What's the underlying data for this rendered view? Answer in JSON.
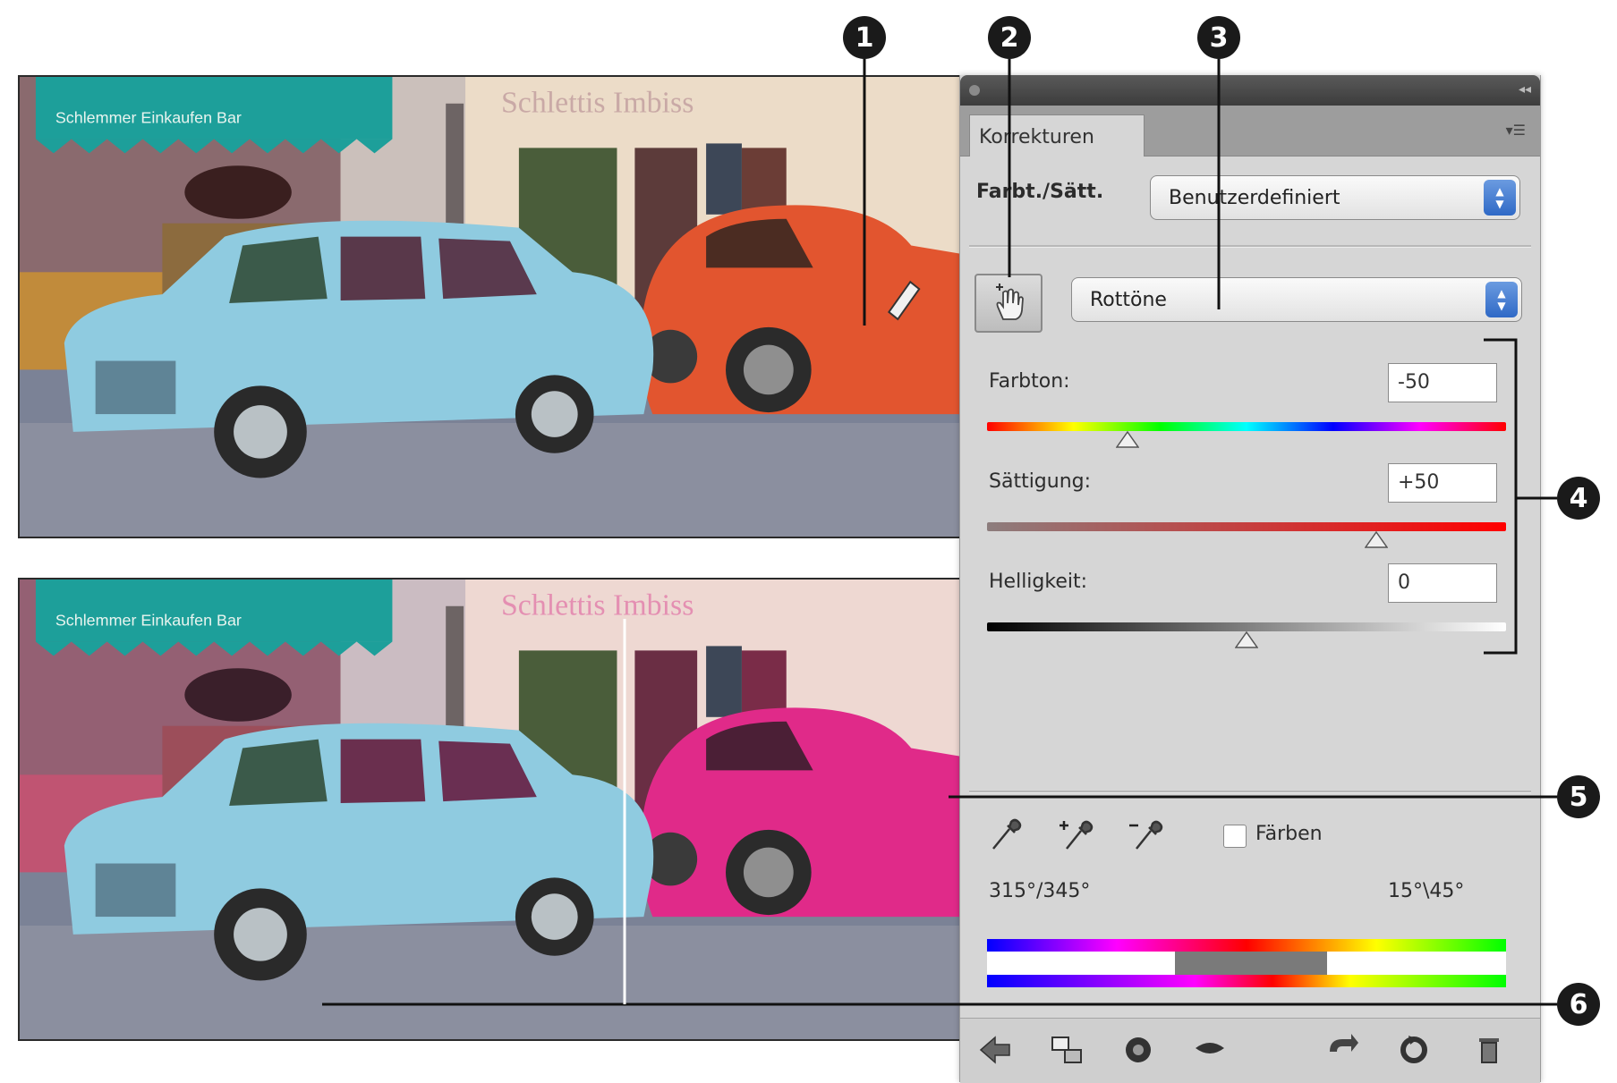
{
  "photo": {
    "awning_text": "Schlemmer  Einkaufen  Bar",
    "sign_text": "Schlettis Imbiss"
  },
  "callouts": [
    "1",
    "2",
    "3",
    "4",
    "5",
    "6"
  ],
  "panel": {
    "tab_label": "Korrekturen",
    "preset_label": "Farbt./Sätt.",
    "preset_value": "Benutzerdefiniert",
    "range_value": "Rottöne",
    "sliders": [
      {
        "label": "Farbton:",
        "value": "-50",
        "level_fraction": 0.27
      },
      {
        "label": "Sättigung:",
        "value": "+50",
        "level_fraction": 0.75
      },
      {
        "label": "Helligkeit:",
        "value": "0",
        "level_fraction": 0.5
      }
    ],
    "colorize_label": "Färben",
    "range_left": "315°/345°",
    "range_right": "15°\\45°"
  },
  "icons": {
    "hand_tool": "hand-target-icon",
    "eyedropper": "eyedropper-icon",
    "eyedropper_add": "eyedropper-plus-icon",
    "eyedropper_subtract": "eyedropper-minus-icon",
    "footer": [
      "back-arrow-icon",
      "clip-layer-icon",
      "visibility-icon",
      "preview-eye-icon",
      "reset-icon",
      "refresh-icon",
      "trash-icon"
    ]
  },
  "colors": {
    "car_before": "#e2552f",
    "car_after": "#e02a89",
    "trabant": "#8fcbe0",
    "awning": "#1d9f9a"
  }
}
